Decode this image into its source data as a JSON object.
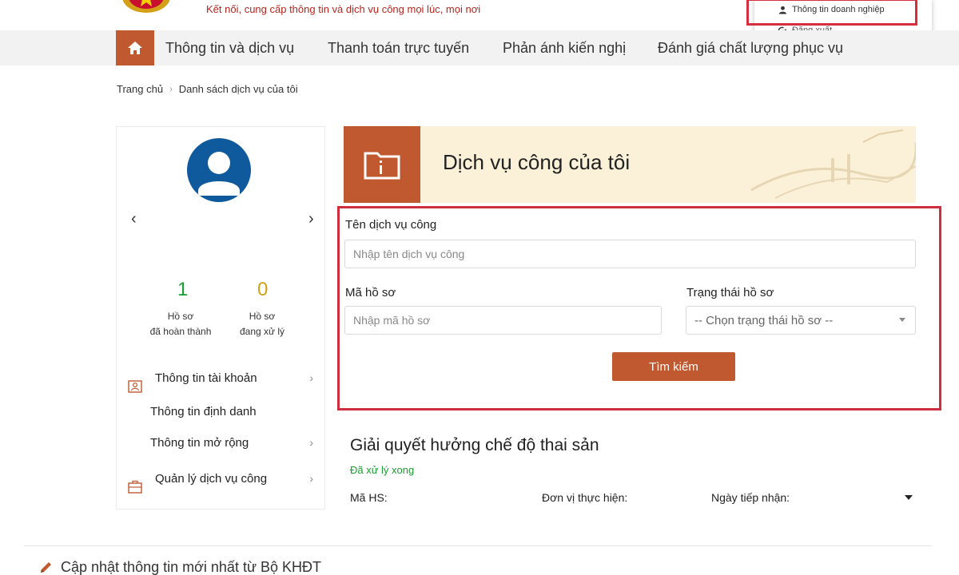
{
  "header": {
    "tagline": "Kết nối, cung cấp thông tin và dịch vụ công mọi lúc, mọi nơi",
    "user_menu": {
      "items": [
        {
          "label": "Thông tin doanh nghiệp",
          "icon": "person-icon"
        },
        {
          "label": "Đăng xuất",
          "icon": "logout-icon"
        }
      ]
    }
  },
  "nav": {
    "home_icon": "home-icon",
    "items": [
      {
        "label": "Thông tin và dịch vụ"
      },
      {
        "label": "Thanh toán trực tuyến"
      },
      {
        "label": "Phản ánh kiến nghị"
      },
      {
        "label": "Đánh giá chất lượng phục vụ"
      }
    ]
  },
  "breadcrumb": {
    "items": [
      "Trang chủ",
      "Danh sách dịch vụ của tôi"
    ],
    "separator": "›"
  },
  "sidebar": {
    "prev": "‹",
    "next": "›",
    "stats": [
      {
        "value": "1",
        "line1": "Hồ sơ",
        "line2": "đã hoàn thành",
        "color": "#1a9c33"
      },
      {
        "value": "0",
        "line1": "Hồ sơ",
        "line2": "đang xử lý",
        "color": "#d4a017"
      }
    ],
    "menu": [
      {
        "label": "Thông tin tài khoản",
        "icon": "account-card-icon",
        "has_chevron": true
      },
      {
        "label": "Thông tin định danh",
        "has_chevron": false
      },
      {
        "label": "Thông tin mở rộng",
        "has_chevron": true
      },
      {
        "label": "Quản lý dịch vụ công",
        "icon": "briefcase-icon",
        "has_chevron": true
      }
    ]
  },
  "banner": {
    "title": "Dịch vụ công của tôi",
    "icon": "folder-info-icon"
  },
  "search": {
    "service_label": "Tên dịch vụ công",
    "service_placeholder": "Nhập tên dịch vụ công",
    "code_label": "Mã hồ sơ",
    "code_placeholder": "Nhập mã hồ sơ",
    "status_label": "Trạng thái hồ sơ",
    "status_selected": "-- Chọn trạng thái hồ sơ --",
    "submit_label": "Tìm kiếm"
  },
  "record": {
    "title": "Giải quyết hưởng chế độ thai sản",
    "status": "Đã xử lý xong",
    "code_label": "Mã HS:",
    "unit_label": "Đơn vị thực hiện:",
    "date_label": "Ngày tiếp nhận:"
  },
  "footer": {
    "link": "Cập nhật thông tin mới nhất từ Bộ KHĐT",
    "icon": "pencil-icon"
  },
  "colors": {
    "accent": "#c0592f",
    "highlight": "#cf2e3e",
    "success": "#1a9c33"
  }
}
